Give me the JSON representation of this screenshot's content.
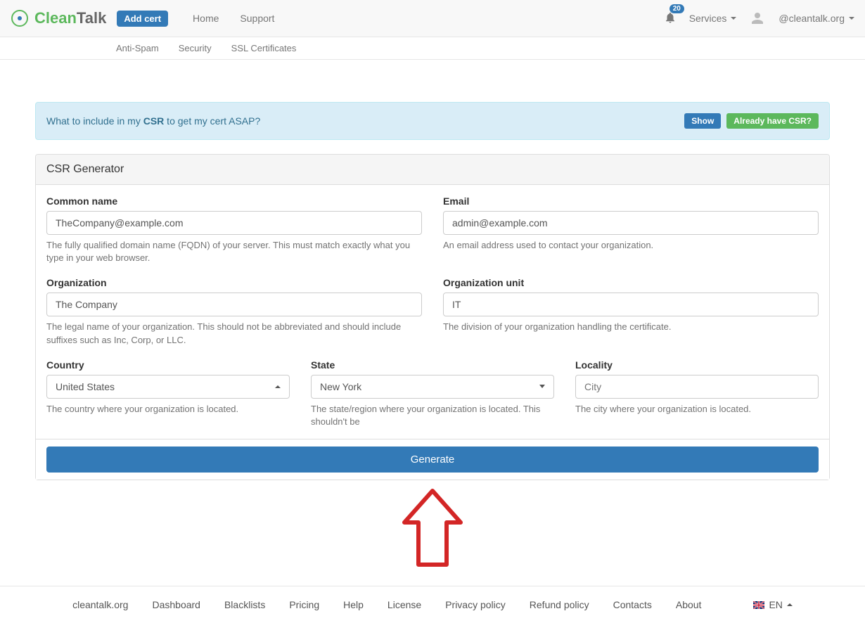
{
  "nav": {
    "logo_clean": "Clean",
    "logo_talk": "Talk",
    "addcert": "Add cert",
    "home": "Home",
    "support": "Support",
    "badge_count": "20",
    "services": "Services",
    "user": "@cleantalk.org"
  },
  "subnav": {
    "antispam": "Anti-Spam",
    "security": "Security",
    "ssl": "SSL Certificates"
  },
  "info": {
    "q_pre": "What to include in my ",
    "q_bold": "CSR",
    "q_post": " to get my cert ASAP?",
    "show": "Show",
    "have": "Already have CSR?"
  },
  "panel": {
    "title": "CSR Generator",
    "generate": "Generate"
  },
  "form": {
    "common_name": {
      "label": "Common name",
      "value": "TheCompany@example.com",
      "help": "The fully qualified domain name (FQDN) of your server. This must match exactly what you type in your web browser."
    },
    "email": {
      "label": "Email",
      "value": "admin@example.com",
      "help": "An email address used to contact your organization."
    },
    "organization": {
      "label": "Organization",
      "value": "The Company",
      "help": "The legal name of your organization. This should not be abbreviated and should include suffixes such as Inc, Corp, or LLC."
    },
    "org_unit": {
      "label": "Organization unit",
      "value": "IT",
      "help": "The division of your organization handling the certificate."
    },
    "country": {
      "label": "Country",
      "value": "United States",
      "help": "The country where your organization is located."
    },
    "state": {
      "label": "State",
      "value": "New York",
      "help": "The state/region where your organization is located. This shouldn't be"
    },
    "locality": {
      "label": "Locality",
      "placeholder": "City",
      "help": "The city where your organization is located."
    }
  },
  "footer": {
    "site": "cleantalk.org",
    "dashboard": "Dashboard",
    "blacklists": "Blacklists",
    "pricing": "Pricing",
    "help": "Help",
    "license": "License",
    "privacy": "Privacy policy",
    "refund": "Refund policy",
    "contacts": "Contacts",
    "about": "About",
    "lang": "EN"
  }
}
